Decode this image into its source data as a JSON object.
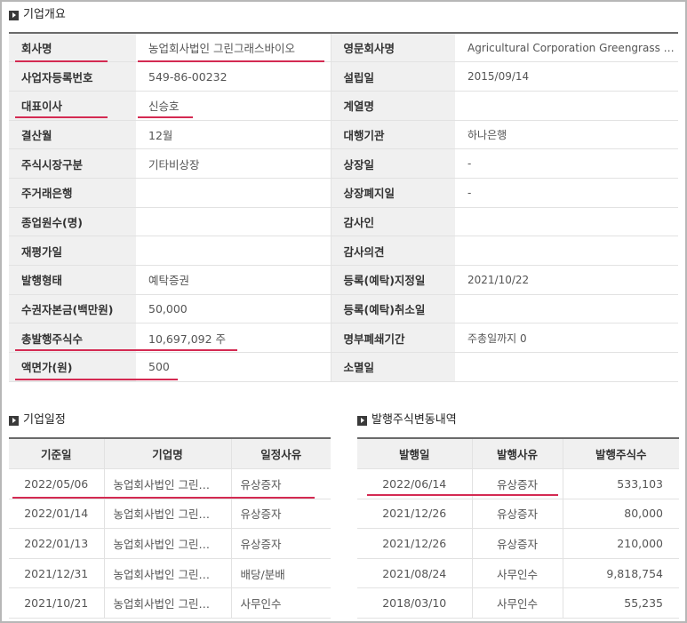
{
  "overview": {
    "title": "기업개요",
    "rows": [
      {
        "l1": "회사명",
        "v1": "농업회사법인 그린그래스바이오",
        "l2": "영문회사명",
        "v2": "Agricultural Corporation Greengrass Bio…"
      },
      {
        "l1": "사업자등록번호",
        "v1": "549-86-00232",
        "l2": "설립일",
        "v2": "2015/09/14"
      },
      {
        "l1": "대표이사",
        "v1": "신승호",
        "l2": "계열명",
        "v2": ""
      },
      {
        "l1": "결산월",
        "v1": "12월",
        "l2": "대행기관",
        "v2": "하나은행"
      },
      {
        "l1": "주식시장구분",
        "v1": "기타비상장",
        "l2": "상장일",
        "v2": "-"
      },
      {
        "l1": "주거래은행",
        "v1": "",
        "l2": "상장폐지일",
        "v2": "-"
      },
      {
        "l1": "종업원수(명)",
        "v1": "",
        "l2": "감사인",
        "v2": ""
      },
      {
        "l1": "재평가일",
        "v1": "",
        "l2": "감사의견",
        "v2": ""
      },
      {
        "l1": "발행형태",
        "v1": "예탁증권",
        "l2": "등록(예탁)지정일",
        "v2": "2021/10/22"
      },
      {
        "l1": "수권자본금(백만원)",
        "v1": "50,000",
        "l2": "등록(예탁)취소일",
        "v2": ""
      },
      {
        "l1": "총발행주식수",
        "v1": "10,697,092 주",
        "l2": "명부폐쇄기간",
        "v2": "주총일까지 0"
      },
      {
        "l1": "액면가(원)",
        "v1": "500",
        "l2": "소멸일",
        "v2": ""
      }
    ]
  },
  "schedule": {
    "title": "기업일정",
    "headers": [
      "기준일",
      "기업명",
      "일정사유"
    ],
    "rows": [
      [
        "2022/05/06",
        "농업회사법인 그린…",
        "유상증자"
      ],
      [
        "2022/01/14",
        "농업회사법인 그린…",
        "유상증자"
      ],
      [
        "2022/01/13",
        "농업회사법인 그린…",
        "유상증자"
      ],
      [
        "2021/12/31",
        "농업회사법인 그린…",
        "배당/분배"
      ],
      [
        "2021/10/21",
        "농업회사법인 그린…",
        "사무인수"
      ]
    ]
  },
  "issuance": {
    "title": "발행주식변동내역",
    "headers": [
      "발행일",
      "발행사유",
      "발행주식수"
    ],
    "rows": [
      [
        "2022/06/14",
        "유상증자",
        "533,103"
      ],
      [
        "2021/12/26",
        "유상증자",
        "80,000"
      ],
      [
        "2021/12/26",
        "유상증자",
        "210,000"
      ],
      [
        "2021/08/24",
        "사무인수",
        "9,818,754"
      ],
      [
        "2018/03/10",
        "사무인수",
        "55,235"
      ]
    ]
  },
  "colors": {
    "accent": "#d42a52",
    "header_bg": "#f0f0f0",
    "border": "#6a6a6a"
  }
}
